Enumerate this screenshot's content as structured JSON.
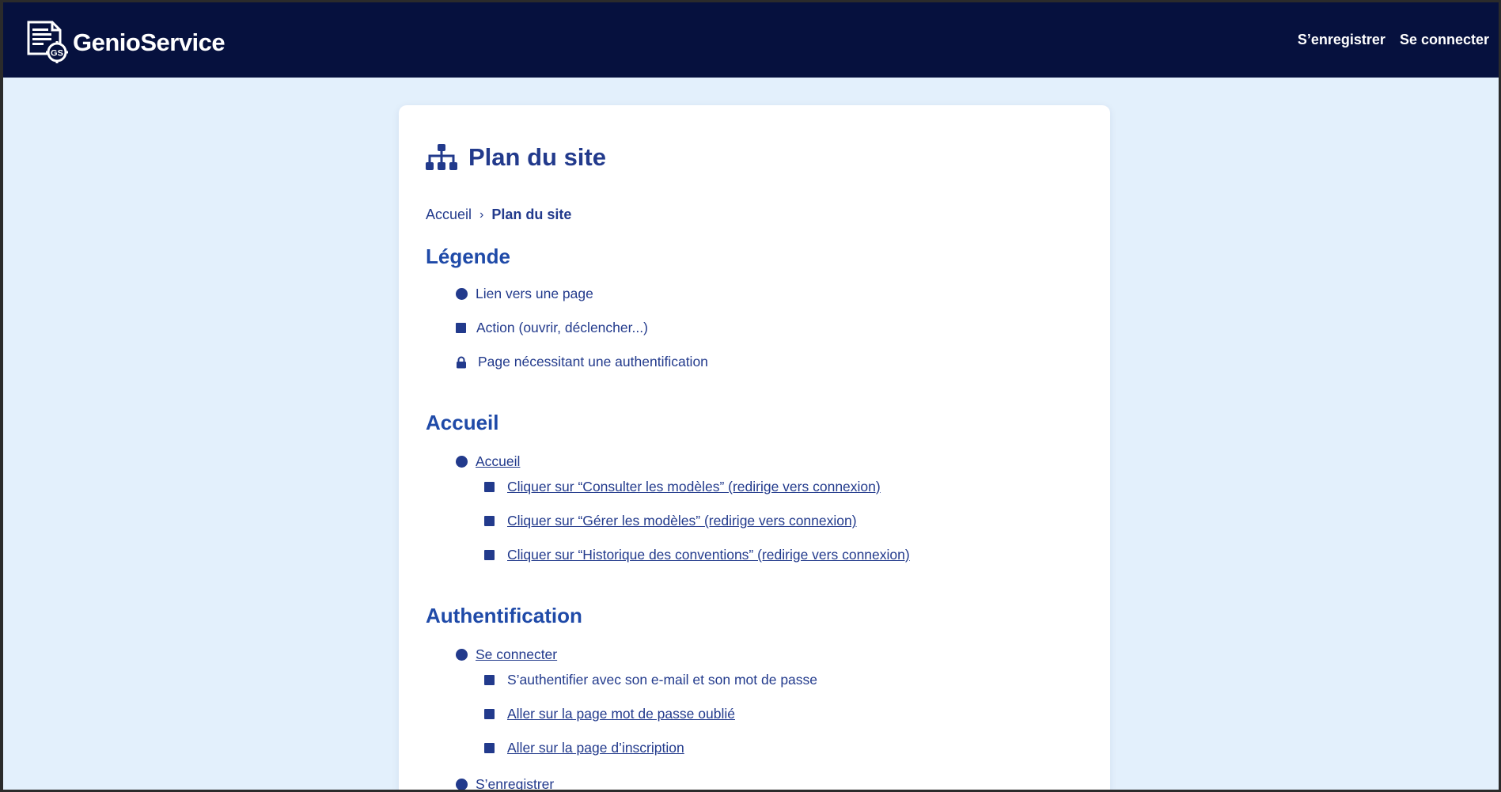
{
  "brand": {
    "name": "GenioService",
    "logo_mark": "GS"
  },
  "topnav": {
    "register": "S’enregistrer",
    "login": "Se connecter"
  },
  "page": {
    "title": "Plan du site"
  },
  "breadcrumb": {
    "home": "Accueil",
    "separator": "›",
    "current": "Plan du site"
  },
  "legend": {
    "title": "Légende",
    "items": [
      {
        "icon": "circle-bullet-icon",
        "label": "Lien vers une page"
      },
      {
        "icon": "square-bullet-icon",
        "label": "Action (ouvrir, déclencher...)"
      },
      {
        "icon": "lock-icon",
        "label": "Page nécessitant une authentification"
      }
    ]
  },
  "accueil_section": {
    "title": "Accueil",
    "page_link": "Accueil",
    "actions": [
      "Cliquer sur “Consulter les modèles” (redirige vers connexion)",
      "Cliquer sur “Gérer les modèles” (redirige vers connexion)",
      "Cliquer sur “Historique des conventions” (redirige vers connexion)"
    ]
  },
  "auth_section": {
    "title": "Authentification",
    "login_link": "Se connecter",
    "login_actions": [
      "S’authentifier avec son e-mail et son mot de passe",
      "Aller sur la page mot de passe oublié",
      "Aller sur la page d’inscription"
    ],
    "register_link": "S’enregistrer"
  },
  "colors": {
    "header_bg": "#06113e",
    "page_bg": "#e3f0fc",
    "accent": "#223a8c",
    "heading": "#1f4aa8"
  }
}
